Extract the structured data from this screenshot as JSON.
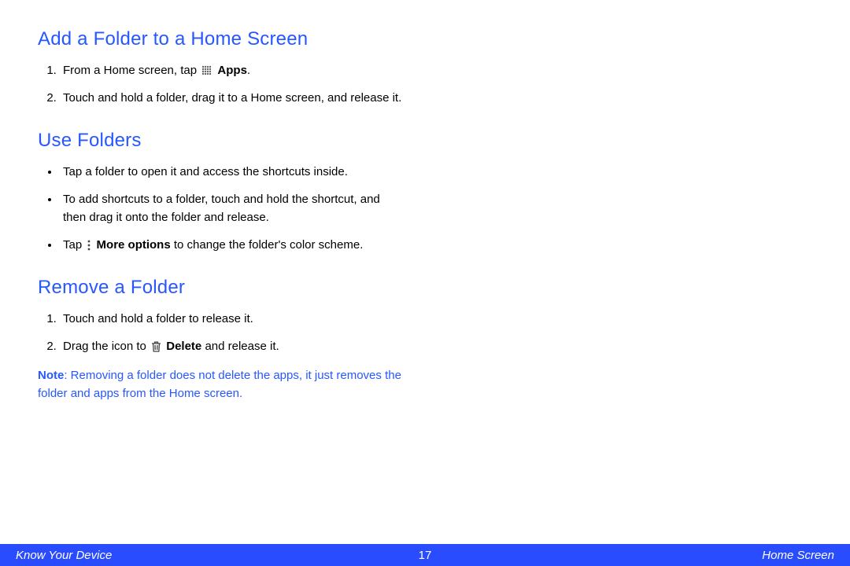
{
  "sections": [
    {
      "heading": "Add a Folder to a Home Screen",
      "steps_prefix": [
        "From a Home screen, tap ",
        "Touch and hold a folder, drag it to a Home screen, and release it."
      ],
      "apps_label": "Apps"
    },
    {
      "heading": "Use Folders",
      "bullets": [
        "Tap a folder to open it and access the shortcuts inside.",
        "To add shortcuts to a folder, touch and hold the shortcut, and then drag it onto the folder and release."
      ],
      "more_prefix": "Tap ",
      "more_label": "More options",
      "more_suffix": " to change the folder's color scheme."
    },
    {
      "heading": "Remove a Folder",
      "steps": [
        "Touch and hold a folder to release it."
      ],
      "delete_prefix": "Drag the icon to ",
      "delete_label": "Delete",
      "delete_suffix": " and release it.",
      "note_label": "Note",
      "note_text": ": Removing a folder does not delete the apps, it just removes the folder and apps from the Home screen."
    }
  ],
  "footer": {
    "left": "Know Your Device",
    "page": "17",
    "right": "Home Screen"
  }
}
